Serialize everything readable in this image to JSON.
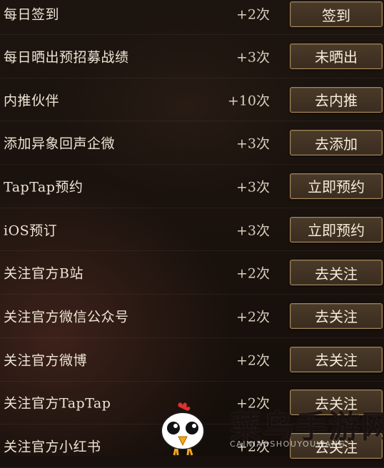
{
  "tasks": [
    {
      "name": "每日签到",
      "reward": "+2次",
      "button": "签到"
    },
    {
      "name": "每日晒出预招募战绩",
      "reward": "+3次",
      "button": "未晒出"
    },
    {
      "name": "内推伙伴",
      "reward": "+10次",
      "button": "去内推"
    },
    {
      "name": "添加异象回声企微",
      "reward": "+3次",
      "button": "去添加"
    },
    {
      "name": "TapTap预约",
      "reward": "+3次",
      "button": "立即预约"
    },
    {
      "name": "iOS预订",
      "reward": "+3次",
      "button": "立即预约"
    },
    {
      "name": "关注官方B站",
      "reward": "+2次",
      "button": "去关注"
    },
    {
      "name": "关注官方微信公众号",
      "reward": "+2次",
      "button": "去关注"
    },
    {
      "name": "关注官方微博",
      "reward": "+2次",
      "button": "去关注"
    },
    {
      "name": "关注官方TapTap",
      "reward": "+2次",
      "button": "去关注"
    },
    {
      "name": "关注官方小红书",
      "reward": "+2次",
      "button": "去关注"
    }
  ],
  "watermark": {
    "text": "菜鸟手游网",
    "subtext": "CAINIAOSHOUYOUWANG",
    "mascot_icon": "chick-mascot-icon"
  },
  "colors": {
    "background": "#17100c",
    "button_border": "#a58556",
    "button_fill": "#3f3024",
    "text": "#eee5d5"
  }
}
